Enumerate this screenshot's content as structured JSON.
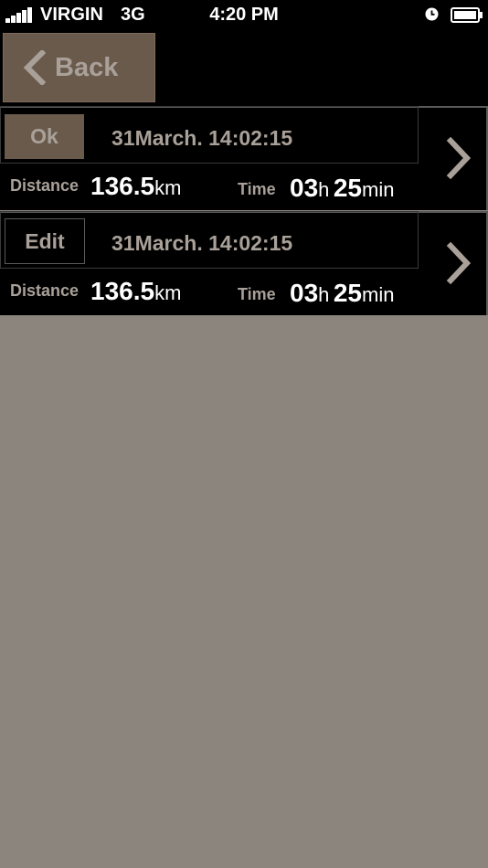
{
  "status_bar": {
    "carrier": "VIRGIN",
    "network": "3G",
    "time": "4:20 PM",
    "icons": [
      "signal-bars-icon",
      "alarm-clock-icon",
      "battery-icon"
    ]
  },
  "nav": {
    "back_label": "Back"
  },
  "records": [
    {
      "button_label": "Ok",
      "datetime": "31March. 14:02:15",
      "distance_label": "Distance",
      "distance_value": "136.5",
      "distance_unit": "km",
      "time_label": "Time",
      "hours": "03",
      "hours_unit": "h",
      "minutes": "25",
      "minutes_unit": "min"
    },
    {
      "button_label": "Edit",
      "datetime": "31March. 14:02:15",
      "distance_label": "Distance",
      "distance_value": "136.5",
      "distance_unit": "km",
      "time_label": "Time",
      "hours": "03",
      "hours_unit": "h",
      "minutes": "25",
      "minutes_unit": "min"
    }
  ],
  "colors": {
    "background": "#8c857d",
    "bar": "#000000",
    "button_brown": "#6a5a4c",
    "muted_text": "#a9a199",
    "value_text": "#ffffff"
  }
}
